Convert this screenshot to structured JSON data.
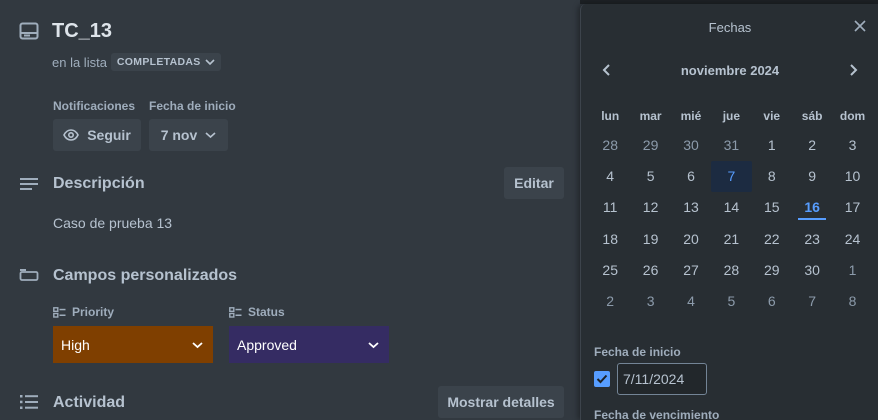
{
  "card": {
    "title": "TC_13",
    "in_list_prefix": "en la lista",
    "list_name": "COMPLETADAS",
    "notifications_label": "Notificaciones",
    "watch_label": "Seguir",
    "start_date_label": "Fecha de inicio",
    "start_date_value": "7 nov",
    "description_heading": "Descripción",
    "edit_label": "Editar",
    "description_text": "Caso de prueba 13",
    "custom_fields_heading": "Campos personalizados",
    "fields": [
      {
        "label": "Priority",
        "value": "High",
        "color": "#7f3f00"
      },
      {
        "label": "Status",
        "value": "Approved",
        "color": "#352c63"
      }
    ],
    "activity_heading": "Actividad",
    "show_details_label": "Mostrar detalles"
  },
  "dates_panel": {
    "title": "Fechas",
    "month_label": "noviembre 2024",
    "weekdays": [
      "lun",
      "mar",
      "mié",
      "jue",
      "vie",
      "sáb",
      "dom"
    ],
    "weeks": [
      [
        "28",
        "29",
        "30",
        "31",
        "1",
        "2",
        "3"
      ],
      [
        "4",
        "5",
        "6",
        "7",
        "8",
        "9",
        "10"
      ],
      [
        "11",
        "12",
        "13",
        "14",
        "15",
        "16",
        "17"
      ],
      [
        "18",
        "19",
        "20",
        "21",
        "22",
        "23",
        "24"
      ],
      [
        "25",
        "26",
        "27",
        "28",
        "29",
        "30",
        "1"
      ],
      [
        "2",
        "3",
        "4",
        "5",
        "6",
        "7",
        "8"
      ]
    ],
    "selected_day": "7",
    "today_day": "16",
    "start_date_label": "Fecha de inicio",
    "start_date_checked": true,
    "start_date_value": "7/11/2024",
    "due_date_label": "Fecha de vencimiento"
  },
  "colors": {
    "accent": "#579dff",
    "priority_high": "#7f3f00",
    "status_approved": "#352c63"
  }
}
